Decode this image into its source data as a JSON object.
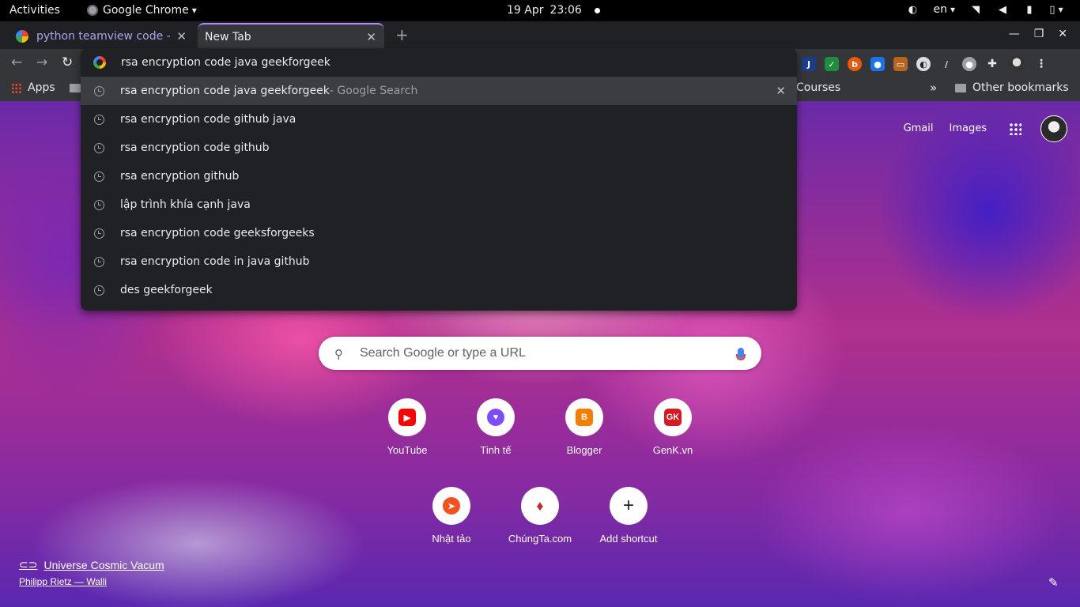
{
  "topbar": {
    "activities": "Activities",
    "app_name": "Google Chrome",
    "date": "19 Apr",
    "time": "23:06",
    "language": "en"
  },
  "tabs": [
    {
      "title": "python teamview code - T",
      "active": false
    },
    {
      "title": "New Tab",
      "active": true
    }
  ],
  "bookmarks": {
    "apps": "Apps",
    "courses": "Courses",
    "more": "»",
    "other": "Other bookmarks"
  },
  "omnibox": {
    "input": "rsa encryption code java geekforgeek",
    "suggestions": [
      {
        "text": "rsa encryption code java geekforgeek",
        "suffix": " - Google Search",
        "selected": true
      },
      {
        "text": "rsa encryption code github java"
      },
      {
        "text": "rsa encryption code github"
      },
      {
        "text": "rsa encryption github"
      },
      {
        "text": "lập trình khía cạnh java"
      },
      {
        "text": "rsa encryption code geeksforgeeks"
      },
      {
        "text": "rsa encryption code in java github"
      },
      {
        "text": "des geekforgeek"
      }
    ]
  },
  "ntp": {
    "gmail": "Gmail",
    "images": "Images",
    "search_placeholder": "Search Google or type a URL",
    "shortcuts": [
      {
        "label": "YouTube",
        "icon": "youtube-icon",
        "color": "#ff0000"
      },
      {
        "label": "Tinh tế",
        "icon": "tinhte-icon",
        "color": "#7b4dff"
      },
      {
        "label": "Blogger",
        "icon": "blogger-icon",
        "color": "#f57d00"
      },
      {
        "label": "GenK.vn",
        "icon": "genk-icon",
        "color": "#d71921"
      },
      {
        "label": "Nhật tảo",
        "icon": "nhattao-icon",
        "color": "#f4511e"
      },
      {
        "label": "ChúngTa.com",
        "icon": "chungta-icon",
        "color": "#c62828"
      },
      {
        "label": "Add shortcut",
        "icon": "plus-icon",
        "color": "#202124"
      }
    ],
    "attribution_title": "Universe Cosmic Vacum",
    "attribution_author": "Philipp Rietz — Walli"
  }
}
